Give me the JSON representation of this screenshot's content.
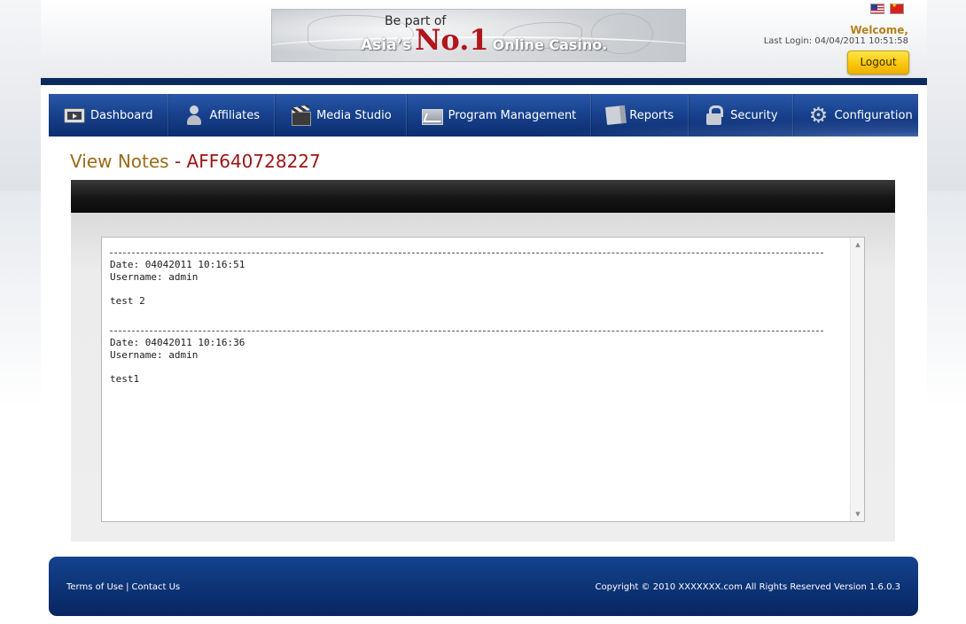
{
  "banner": {
    "line1": "Be part of",
    "asias": "Asia’s",
    "no1": "No.1",
    "casino": "Online Casino."
  },
  "header": {
    "languages": [
      "english-flag",
      "chinese-flag"
    ],
    "welcome": "Welcome,",
    "last_login": "Last Login: 04/04/2011 10:51:58",
    "logout_label": "Logout"
  },
  "nav": {
    "items": [
      {
        "label": "Dashboard",
        "icon": "dashboard-icon"
      },
      {
        "label": "Affiliates",
        "icon": "affiliates-icon"
      },
      {
        "label": "Media Studio",
        "icon": "clapperboard-icon"
      },
      {
        "label": "Program Management",
        "icon": "chart-icon"
      },
      {
        "label": "Reports",
        "icon": "report-icon"
      },
      {
        "label": "Security",
        "icon": "lock-icon"
      },
      {
        "label": "Configuration",
        "icon": "gear-icon"
      }
    ]
  },
  "page": {
    "title": "View Notes",
    "title_sep": "-",
    "affiliate_id": "AFF640728227"
  },
  "notes": [
    {
      "date": "Date: 04042011 10:16:51",
      "username": "Username: admin",
      "text": "test 2"
    },
    {
      "date": "Date: 04042011 10:16:36",
      "username": "Username: admin",
      "text": "test1"
    }
  ],
  "footer": {
    "terms": "Terms of Use",
    "separator": "|",
    "contact": "Contact Us",
    "copyright": "Copyright © 2010 XXXXXXX.com All Rights Reserved  Version 1.6.0.3"
  },
  "colors": {
    "nav_blue": "#18428e",
    "title_gold": "#9b6b16",
    "title_red": "#9c1515",
    "logout_yellow": "#f9c80e"
  }
}
